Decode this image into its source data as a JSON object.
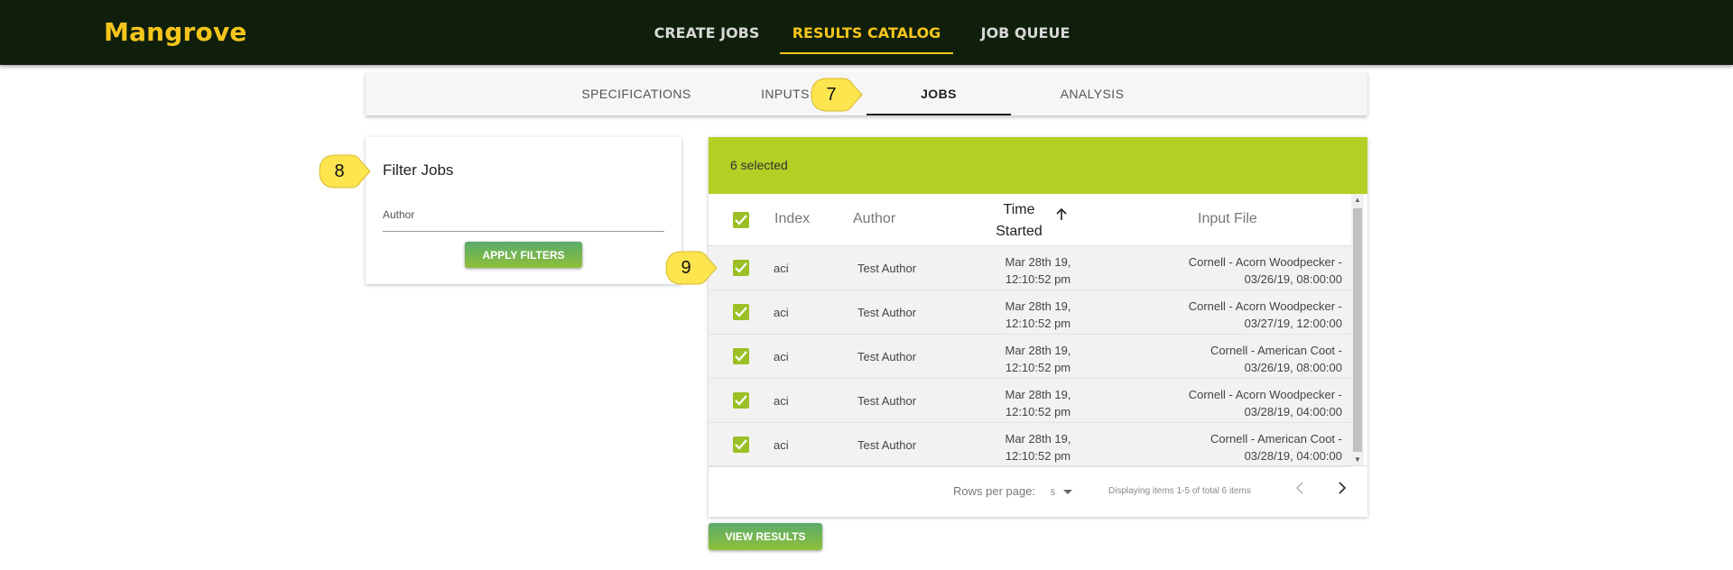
{
  "app": {
    "logo": "Mangrove"
  },
  "nav": {
    "create_jobs": "CREATE JOBS",
    "results_catalog": "RESULTS CATALOG",
    "job_queue": "JOB QUEUE"
  },
  "subtabs": {
    "specifications": "SPECIFICATIONS",
    "inputs": "INPUTS",
    "jobs": "JOBS",
    "analysis": "ANALYSIS"
  },
  "filter": {
    "title": "Filter Jobs",
    "author_label": "Author",
    "apply_label": "APPLY FILTERS"
  },
  "table": {
    "selected_text": "6 selected",
    "headers": {
      "index": "Index",
      "author": "Author",
      "time_line1": "Time",
      "time_line2": "Started",
      "input_file": "Input File"
    },
    "rows": [
      {
        "index": "aci",
        "author": "Test Author",
        "time1": "Mar 28th 19,",
        "time2": "12:10:52 pm",
        "file1": "Cornell - Acorn Woodpecker -",
        "file2": "03/26/19, 08:00:00",
        "checked": true
      },
      {
        "index": "aci",
        "author": "Test Author",
        "time1": "Mar 28th 19,",
        "time2": "12:10:52 pm",
        "file1": "Cornell - Acorn Woodpecker -",
        "file2": "03/27/19, 12:00:00",
        "checked": true
      },
      {
        "index": "aci",
        "author": "Test Author",
        "time1": "Mar 28th 19,",
        "time2": "12:10:52 pm",
        "file1": "Cornell - American Coot -",
        "file2": "03/26/19, 08:00:00",
        "checked": true
      },
      {
        "index": "aci",
        "author": "Test Author",
        "time1": "Mar 28th 19,",
        "time2": "12:10:52 pm",
        "file1": "Cornell - Acorn Woodpecker -",
        "file2": "03/28/19, 04:00:00",
        "checked": true
      },
      {
        "index": "aci",
        "author": "Test Author",
        "time1": "Mar 28th 19,",
        "time2": "12:10:52 pm",
        "file1": "Cornell - American Coot -",
        "file2": "03/28/19, 04:00:00",
        "checked": true
      }
    ],
    "footer": {
      "rows_per_page_label": "Rows per page:",
      "rows_per_page_value": "5",
      "displaying": "Displaying items 1-5 of total 6 items"
    }
  },
  "view_results_label": "VIEW RESULTS",
  "callouts": {
    "c7": "7",
    "c8": "8",
    "c9": "9"
  },
  "colors": {
    "appbar": "#0f1f0b",
    "brand_yellow": "#f6c51b",
    "selection_bar": "#b5cf25",
    "checkbox": "#9bbf26",
    "callout": "#fde54f"
  },
  "icons": {
    "sort": "arrow-up-icon",
    "checkbox": "check-icon",
    "prev": "chevron-left-icon",
    "next": "chevron-right-icon"
  }
}
